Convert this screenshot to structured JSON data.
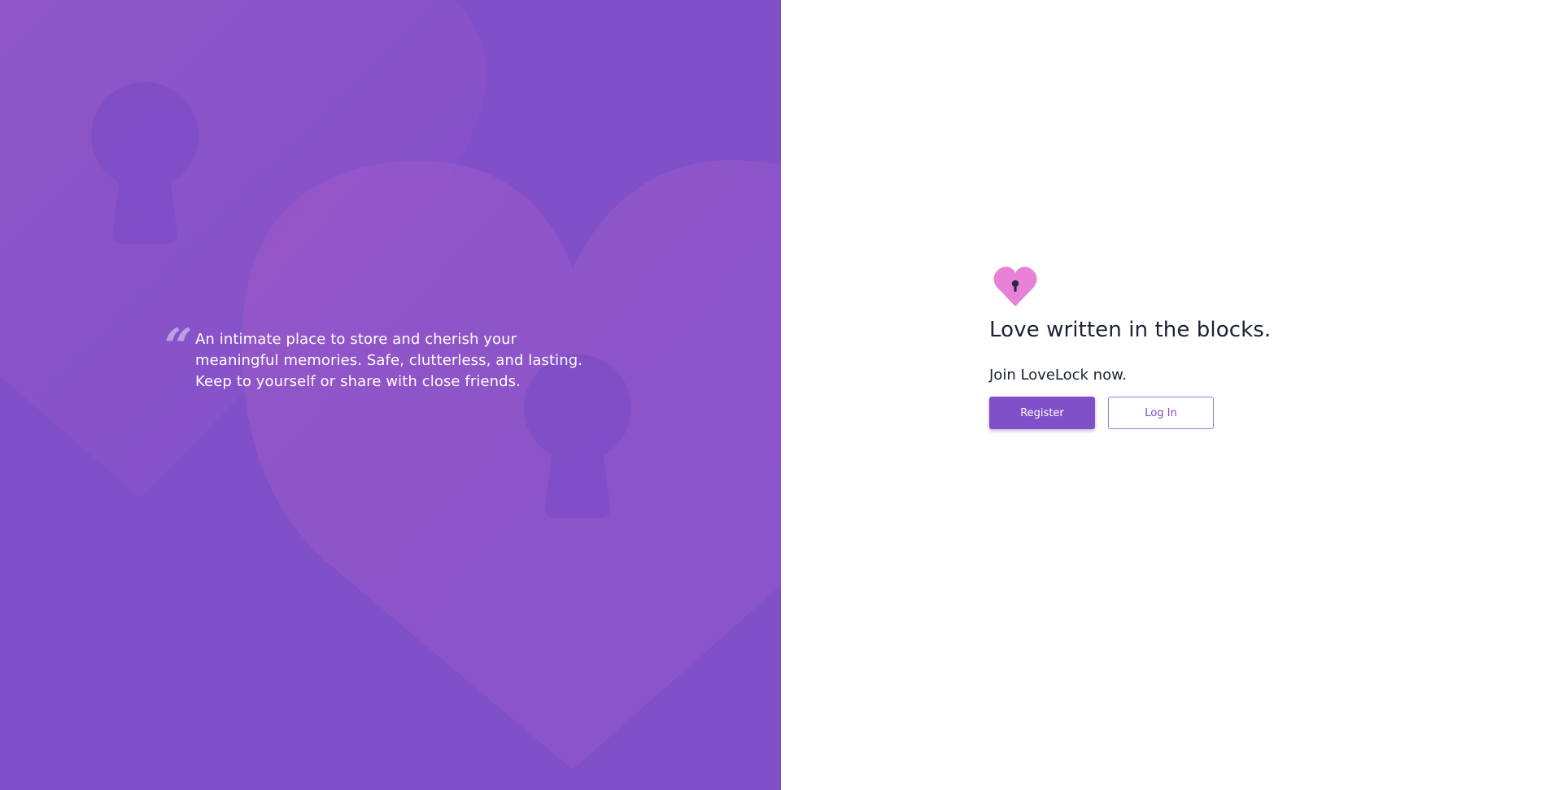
{
  "hero": {
    "quote_mark": "“",
    "quote_text": "An intimate place to store and cherish your meaningful memories. Safe, clutterless, and lasting. Keep to yourself or share with close friends."
  },
  "auth": {
    "logo_icon": "heart-keyhole-icon",
    "headline": "Love written in the blocks.",
    "subline": "Join LoveLock now.",
    "register_label": "Register",
    "login_label": "Log In"
  },
  "colors": {
    "brand_purple": "#8050c8",
    "logo_pink": "#e882d6",
    "text_dark": "#1b2233",
    "white": "#ffffff"
  }
}
